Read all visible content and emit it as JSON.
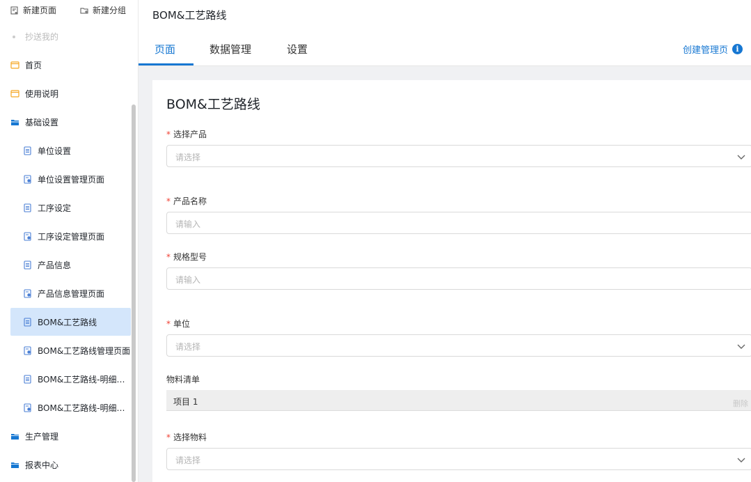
{
  "sidebar": {
    "new_page": "新建页面",
    "new_group": "新建分组",
    "cc_me": "抄送我的",
    "items": [
      {
        "label": "首页",
        "icon": "page-icon",
        "level": "top"
      },
      {
        "label": "使用说明",
        "icon": "page-icon",
        "level": "top"
      },
      {
        "label": "基础设置",
        "icon": "folder-open-icon",
        "level": "top"
      },
      {
        "label": "单位设置",
        "icon": "form-icon",
        "level": "child"
      },
      {
        "label": "单位设置管理页面",
        "icon": "manage-page-icon",
        "level": "child"
      },
      {
        "label": "工序设定",
        "icon": "form-icon",
        "level": "child"
      },
      {
        "label": "工序设定管理页面",
        "icon": "manage-page-icon",
        "level": "child"
      },
      {
        "label": "产品信息",
        "icon": "form-icon",
        "level": "child"
      },
      {
        "label": "产品信息管理页面",
        "icon": "manage-page-icon",
        "level": "child"
      },
      {
        "label": "BOM&工艺路线",
        "icon": "form-icon",
        "level": "child",
        "active": true
      },
      {
        "label": "BOM&工艺路线管理页面",
        "icon": "manage-page-icon",
        "level": "child"
      },
      {
        "label": "BOM&工艺路线-明细统计",
        "icon": "form-icon",
        "level": "child"
      },
      {
        "label": "BOM&工艺路线-明细统...",
        "icon": "manage-page-icon",
        "level": "child"
      },
      {
        "label": "生产管理",
        "icon": "folder-icon",
        "level": "top"
      },
      {
        "label": "报表中心",
        "icon": "folder-icon",
        "level": "top"
      }
    ]
  },
  "header": {
    "title": "BOM&工艺路线",
    "tabs": [
      {
        "label": "页面",
        "active": true
      },
      {
        "label": "数据管理",
        "active": false
      },
      {
        "label": "设置",
        "active": false
      }
    ],
    "create_link": "创建管理页",
    "info_glyph": "i"
  },
  "form": {
    "title": "BOM&工艺路线",
    "fields": [
      {
        "label": "选择产品",
        "required": true,
        "placeholder": "请选择",
        "type": "select"
      },
      {
        "label": "产品名称",
        "required": true,
        "placeholder": "请输入",
        "type": "input"
      },
      {
        "label": "规格型号",
        "required": true,
        "placeholder": "请输入",
        "type": "input"
      },
      {
        "label": "单位",
        "required": true,
        "placeholder": "请选择",
        "type": "select"
      }
    ],
    "subtable": {
      "label": "物料清单",
      "item_title": "项目 1",
      "delete_label": "删除"
    },
    "material_field": {
      "label": "选择物料",
      "required": true,
      "placeholder": "请选择",
      "type": "select"
    }
  },
  "colors": {
    "accent": "#1677d2",
    "active_bg": "#d4e6fb",
    "required": "#f04134",
    "top_icon": "#f5a623"
  }
}
